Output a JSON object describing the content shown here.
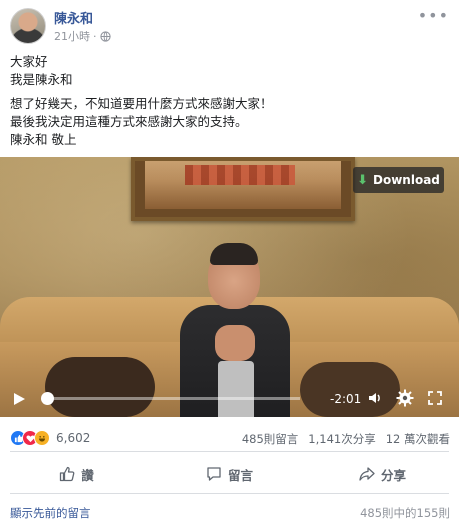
{
  "post": {
    "author": "陳永和",
    "time": "21小時",
    "separator": "·",
    "privacy_icon": "globe-icon",
    "more_icon": "more-options-icon",
    "more_text": "•••",
    "lines": [
      "大家好",
      "我是陳永和",
      "想了好幾天，不知道要用什麼方式來感謝大家！",
      "最後我決定用這種方式來感謝大家的支持。",
      "陳永和 敬上"
    ]
  },
  "video": {
    "download_label": "Download",
    "download_icon": "download-arrow-icon",
    "time_remaining": "-2:01",
    "progress_fraction": 0.01,
    "play_icon": "play-icon",
    "volume_icon": "volume-icon",
    "settings_icon": "gear-icon",
    "fullscreen_icon": "fullscreen-icon"
  },
  "stats": {
    "reaction_icons": [
      "like-icon",
      "love-icon",
      "haha-icon"
    ],
    "reaction_count": "6,602",
    "comments": "485則留言",
    "shares": "1,141次分享",
    "views": "12 萬次觀看"
  },
  "actions": {
    "like_label": "讚",
    "comment_label": "留言",
    "share_label": "分享"
  },
  "comments_bar": {
    "prev_label": "顯示先前的留言",
    "count_label": "485則中的155則"
  },
  "colors": {
    "link_blue": "#385898",
    "muted_gray": "#90949c",
    "action_gray": "#606770",
    "like_blue": "#2078f4",
    "love_red": "#f0284a",
    "haha_yellow": "#f7b125",
    "download_green": "#5bc16d"
  }
}
